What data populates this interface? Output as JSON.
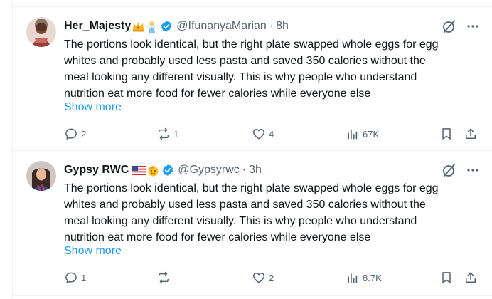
{
  "tweets": [
    {
      "display_name": "Her_Majesty",
      "handle": "@IfunanyaMarian",
      "separator": "·",
      "time": "8h",
      "text_lines": [
        "The portions look identical, but the right plate swapped whole eggs for egg",
        "whites and probably used less pasta and saved 350 calories without the",
        "meal looking any different visually. This is why people who understand",
        "nutrition eat more food for fewer calories while everyone else"
      ],
      "show_more": "Show more",
      "replies": "2",
      "reposts": "1",
      "likes": "4",
      "views": "67K",
      "name_emojis": [
        "crown-emoji",
        "fairy-emoji"
      ]
    },
    {
      "display_name": "Gypsy RWC",
      "handle": "@Gypsyrwc",
      "separator": "·",
      "time": "3h",
      "text_lines": [
        "The portions look identical, but the right plate swapped whole eggs for egg",
        "whites and probably used less pasta and saved 350 calories without the",
        "meal looking any different visually. This is why people who understand",
        "nutrition eat more food for fewer calories while everyone else"
      ],
      "show_more": "Show more",
      "replies": "1",
      "reposts": "",
      "likes": "2",
      "views": "8.7K",
      "name_emojis": [
        "us-flag-emoji",
        "saluting-face-emoji"
      ]
    }
  ],
  "colors": {
    "text": "#0f1419",
    "secondary": "#536471",
    "link": "#1d9bf0",
    "verified": "#1d9bf0",
    "divider": "#eff3f4"
  }
}
